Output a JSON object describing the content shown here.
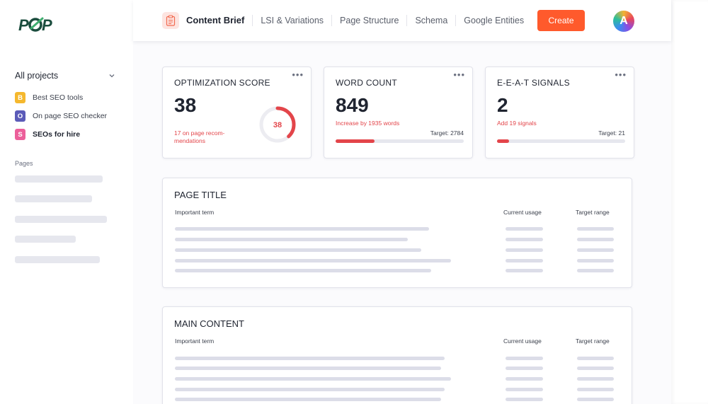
{
  "app": {
    "logo_text": "POP"
  },
  "sidebar": {
    "projects_header": "All projects",
    "projects": [
      {
        "badge": "B",
        "label": "Best SEO tools",
        "color": "#f5b82e",
        "active": false
      },
      {
        "badge": "O",
        "label": "On page SEO checker",
        "color": "#5b5bb8",
        "active": false
      },
      {
        "badge": "S",
        "label": "SEOs for hire",
        "color": "#ec5f9a",
        "active": true
      }
    ],
    "pages_label": "Pages"
  },
  "topbar": {
    "active_tab": "Content Brief",
    "tabs": [
      "LSI & Variations",
      "Page Structure",
      "Schema",
      "Google Entities"
    ],
    "create_label": "Create",
    "avatar_initial": "A"
  },
  "cards": {
    "optimization": {
      "title": "OPTIMIZATION SCORE",
      "value": "38",
      "note": "17 on page recom-\nmendations",
      "dots": "•••",
      "donut_value": "38",
      "score_fraction": 0.38
    },
    "word_count": {
      "title": "WORD COUNT",
      "value": "849",
      "note": "Increase by 1935 words",
      "target": "Target: 2784",
      "dots": "•••",
      "progress_fraction": 0.305
    },
    "eeat": {
      "title": "E-E-A-T SIGNALS",
      "value": "2",
      "note": "Add 19 signals",
      "target": "Target: 21",
      "dots": "•••",
      "progress_fraction": 0.095
    }
  },
  "sections": {
    "page_title": {
      "title": "PAGE TITLE",
      "col_term": "Important term",
      "col_usage": "Current usage",
      "col_target": "Target range"
    },
    "main_content": {
      "title": "MAIN CONTENT",
      "col_term": "Important term",
      "col_usage": "Current usage",
      "col_target": "Target range"
    }
  },
  "colors": {
    "accent": "#ff5a2c",
    "alert": "#e3454a",
    "placeholder": "#dcdde8"
  }
}
